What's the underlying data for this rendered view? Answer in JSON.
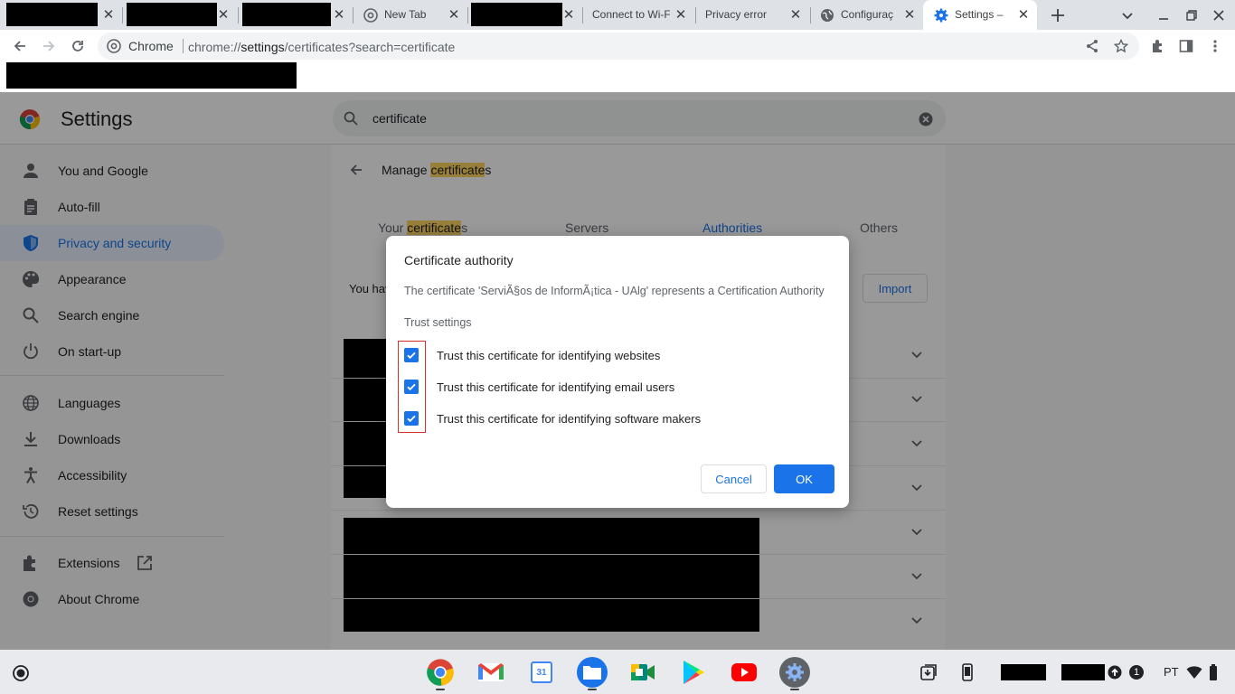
{
  "tabs": [
    {
      "title": "",
      "close": "✕"
    },
    {
      "title": "",
      "close": "✕"
    },
    {
      "title": "",
      "close": "✕"
    },
    {
      "title": "New Tab",
      "close": "✕"
    },
    {
      "title": "",
      "close": "✕"
    },
    {
      "title": "Connect to Wi-Fi",
      "close": "✕"
    },
    {
      "title": "Privacy error",
      "close": "✕"
    },
    {
      "title": "Configuraç",
      "close": "✕"
    },
    {
      "title": "Settings – ",
      "close": "✕"
    }
  ],
  "toolbar": {
    "site_chip": "Chrome",
    "url_scheme": "chrome://",
    "url_host": "settings",
    "url_path": "/certificates?search=certificate"
  },
  "settings": {
    "title": "Settings",
    "search_value": "certificate",
    "nav": [
      {
        "label": "You and Google",
        "icon": "person-icon"
      },
      {
        "label": "Auto-fill",
        "icon": "clipboard-icon"
      },
      {
        "label": "Privacy and security",
        "icon": "shield-icon"
      },
      {
        "label": "Appearance",
        "icon": "palette-icon"
      },
      {
        "label": "Search engine",
        "icon": "search-icon"
      },
      {
        "label": "On start-up",
        "icon": "power-icon"
      },
      {
        "label": "Languages",
        "icon": "globe-icon"
      },
      {
        "label": "Downloads",
        "icon": "download-icon"
      },
      {
        "label": "Accessibility",
        "icon": "accessibility-icon"
      },
      {
        "label": "Reset settings",
        "icon": "history-icon"
      },
      {
        "label": "Extensions",
        "icon": "puzzle-icon"
      },
      {
        "label": "About Chrome",
        "icon": "chrome-icon"
      }
    ],
    "manage_prefix": "Manage ",
    "manage_highlight": "certificate",
    "manage_suffix": "s",
    "cert_tabs": {
      "yours_prefix": "Your ",
      "yours_highlight": "certificate",
      "yours_suffix": "s",
      "servers": "Servers",
      "authorities": "Authorities",
      "others": "Others"
    },
    "you_have_text": "You hav",
    "import_label": "Import"
  },
  "dialog": {
    "title": "Certificate authority",
    "description": "The certificate 'ServiÃ§os de InformÃ¡tica - UAlg' represents a Certification Authority",
    "trust_heading": "Trust settings",
    "options": [
      {
        "label": "Trust this certificate for identifying websites",
        "checked": true
      },
      {
        "label": "Trust this certificate for identifying email users",
        "checked": true
      },
      {
        "label": "Trust this certificate for identifying software makers",
        "checked": true
      }
    ],
    "cancel_label": "Cancel",
    "ok_label": "OK"
  },
  "shelf": {
    "apps": [
      "Chrome",
      "Gmail",
      "Calendar",
      "Files",
      "Meet",
      "Play Store",
      "YouTube",
      "Settings"
    ],
    "calendar_day": "31",
    "notification_count": "1",
    "language": "PT"
  },
  "colors": {
    "accent": "#1a73e8",
    "highlight": "#fdd663",
    "red_outline": "#d93025"
  }
}
